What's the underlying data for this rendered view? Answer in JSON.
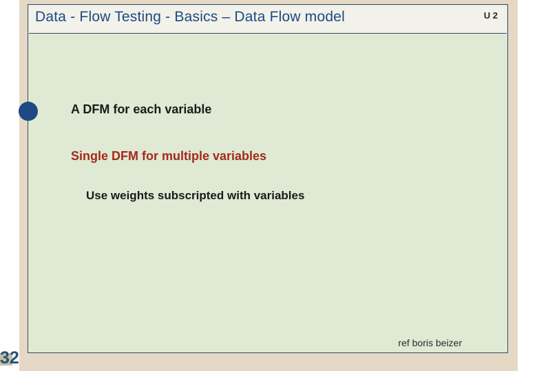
{
  "slide_number": "32",
  "unit": "U 2",
  "title": "Data - Flow Testing   -  Basics – Data Flow model",
  "bullets": {
    "b1": "A DFM for each variable",
    "b2": "Single DFM for multiple variables",
    "b3": "Use weights subscripted with variables"
  },
  "footer_ref": "ref boris beizer"
}
